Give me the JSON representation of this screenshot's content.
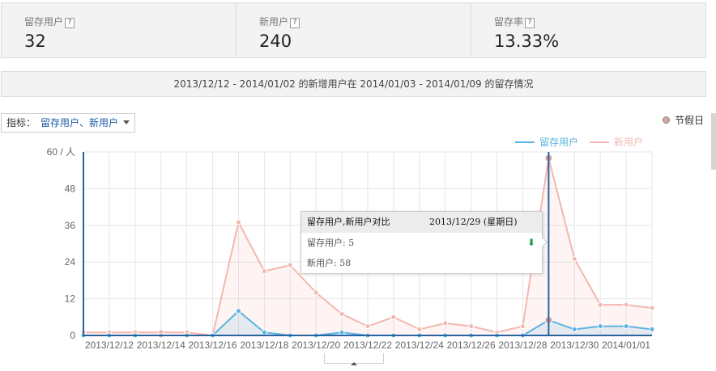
{
  "stats": [
    {
      "label": "留存用户",
      "value": "32",
      "help": "?"
    },
    {
      "label": "新用户",
      "value": "240",
      "help": "?"
    },
    {
      "label": "留存率",
      "value": "13.33%",
      "help": "?"
    }
  ],
  "range_text": "2013/12/12 - 2014/01/02 的新增用户在 2014/01/03 - 2014/01/09 的留存情况",
  "indicator": {
    "label": "指标：",
    "value": "留存用户、新用户"
  },
  "holiday_legend": "节假日",
  "tooltip": {
    "title": "留存用户,新用户对比",
    "date": "2013/12/29 (星期日)",
    "rows": [
      "留存用户: 5",
      "新用户: 58"
    ]
  },
  "colors": {
    "retained": "#5ab4e0",
    "new_users": "#f2b8b0",
    "axis": "#2a63a0",
    "holiday": "#d9a3a0"
  },
  "chart_data": {
    "type": "line",
    "ylabel": "60 / 人",
    "yticks": [
      "0",
      "12",
      "24",
      "36",
      "48"
    ],
    "ylim": [
      0,
      60
    ],
    "x": [
      "2013/12/11",
      "2013/12/12",
      "2013/12/13",
      "2013/12/14",
      "2013/12/15",
      "2013/12/16",
      "2013/12/17",
      "2013/12/18",
      "2013/12/19",
      "2013/12/20",
      "2013/12/21",
      "2013/12/22",
      "2013/12/23",
      "2013/12/24",
      "2013/12/25",
      "2013/12/26",
      "2013/12/27",
      "2013/12/28",
      "2013/12/29",
      "2013/12/30",
      "2013/12/31",
      "2014/01/01",
      "2014/01/02"
    ],
    "xticks": [
      "2013/12/12",
      "2013/12/14",
      "2013/12/16",
      "2013/12/18",
      "2013/12/20",
      "2013/12/22",
      "2013/12/24",
      "2013/12/26",
      "2013/12/28",
      "2013/12/30",
      "2014/01/01"
    ],
    "legend": [
      "留存用户",
      "新用户"
    ],
    "legend_position": "top-right",
    "series": [
      {
        "name": "留存用户",
        "values": [
          0,
          0,
          0,
          0,
          0,
          0,
          8,
          1,
          0,
          0,
          1,
          0,
          0,
          0,
          0,
          0,
          0,
          0,
          5,
          2,
          3,
          3,
          2
        ]
      },
      {
        "name": "新用户",
        "values": [
          1,
          1,
          1,
          1,
          1,
          0,
          37,
          21,
          23,
          14,
          7,
          3,
          6,
          2,
          4,
          3,
          1,
          3,
          58,
          25,
          10,
          10,
          9
        ]
      }
    ],
    "holidays": [
      "2013/12/14",
      "2013/12/29"
    ],
    "highlight": "2013/12/29"
  }
}
